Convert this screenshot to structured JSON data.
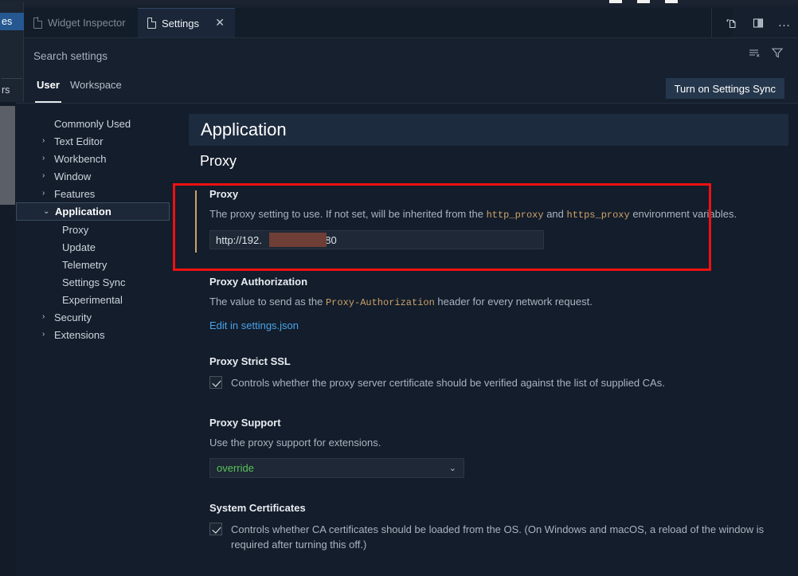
{
  "window": {
    "controls": [
      "minimize",
      "maximize",
      "close"
    ]
  },
  "left_menu": {
    "selected_item_fragment": "es",
    "second_item_fragment": "rs"
  },
  "tabs": [
    {
      "label": "Widget Inspector",
      "icon": "file-icon",
      "active": false,
      "closable": false
    },
    {
      "label": "Settings",
      "icon": "file-icon",
      "active": true,
      "closable": true,
      "close_glyph": "✕"
    }
  ],
  "editor_actions": [
    {
      "name": "open-changes-icon",
      "title": "Open Changes"
    },
    {
      "name": "split-editor-icon",
      "title": "Split Editor"
    },
    {
      "name": "more-actions-icon",
      "title": "More Actions...",
      "glyph": "…"
    }
  ],
  "search": {
    "value": "",
    "placeholder": "Search settings",
    "icons": [
      {
        "name": "clear-settings-search-icon",
        "title": "Clear Settings Search Results"
      },
      {
        "name": "filter-settings-icon",
        "title": "Filter Settings"
      }
    ]
  },
  "scope": {
    "tabs": [
      {
        "label": "User",
        "selected": true
      },
      {
        "label": "Workspace",
        "selected": false
      }
    ],
    "sync_button": "Turn on Settings Sync"
  },
  "toc": {
    "items": [
      {
        "label": "Commonly Used",
        "level": 0,
        "expandable": false,
        "expanded": false,
        "selected": false
      },
      {
        "label": "Text Editor",
        "level": 0,
        "expandable": true,
        "expanded": false,
        "selected": false
      },
      {
        "label": "Workbench",
        "level": 0,
        "expandable": true,
        "expanded": false,
        "selected": false
      },
      {
        "label": "Window",
        "level": 0,
        "expandable": true,
        "expanded": false,
        "selected": false
      },
      {
        "label": "Features",
        "level": 0,
        "expandable": true,
        "expanded": false,
        "selected": false
      },
      {
        "label": "Application",
        "level": 0,
        "expandable": true,
        "expanded": true,
        "selected": true
      },
      {
        "label": "Proxy",
        "level": 1,
        "expandable": false,
        "expanded": false,
        "selected": false
      },
      {
        "label": "Update",
        "level": 1,
        "expandable": false,
        "expanded": false,
        "selected": false
      },
      {
        "label": "Telemetry",
        "level": 1,
        "expandable": false,
        "expanded": false,
        "selected": false
      },
      {
        "label": "Settings Sync",
        "level": 1,
        "expandable": false,
        "expanded": false,
        "selected": false
      },
      {
        "label": "Experimental",
        "level": 1,
        "expandable": false,
        "expanded": false,
        "selected": false
      },
      {
        "label": "Security",
        "level": 0,
        "expandable": true,
        "expanded": false,
        "selected": false
      },
      {
        "label": "Extensions",
        "level": 0,
        "expandable": true,
        "expanded": false,
        "selected": false
      }
    ],
    "chevron_collapsed": "›",
    "chevron_expanded": "⌄"
  },
  "pane": {
    "group_header": "Application",
    "section_header": "Proxy"
  },
  "settings": {
    "proxy": {
      "title": "Proxy",
      "desc_part1": "The proxy setting to use. If not set, will be inherited from the ",
      "desc_code1": "http_proxy",
      "desc_part2": " and ",
      "desc_code2": "https_proxy",
      "desc_part3": " environment variables.",
      "value": "http://192.                 :1080",
      "modified": true
    },
    "proxy_authorization": {
      "title": "Proxy Authorization",
      "desc_part1": "The value to send as the ",
      "desc_code1": "Proxy-Authorization",
      "desc_part2": " header for every network request.",
      "link": "Edit in settings.json"
    },
    "proxy_strict_ssl": {
      "title": "Proxy Strict SSL",
      "checkbox_label": "Controls whether the proxy server certificate should be verified against the list of supplied CAs.",
      "checked": true
    },
    "proxy_support": {
      "title": "Proxy Support",
      "desc": "Use the proxy support for extensions.",
      "value": "override",
      "chevron": "⌄"
    },
    "system_certificates": {
      "title": "System Certificates",
      "checkbox_label": "Controls whether CA certificates should be loaded from the OS. (On Windows and macOS, a reload of the window is required after turning this off.)",
      "checked": true
    }
  },
  "annotation": {
    "color": "#ee1111",
    "target": "proxy-setting"
  }
}
